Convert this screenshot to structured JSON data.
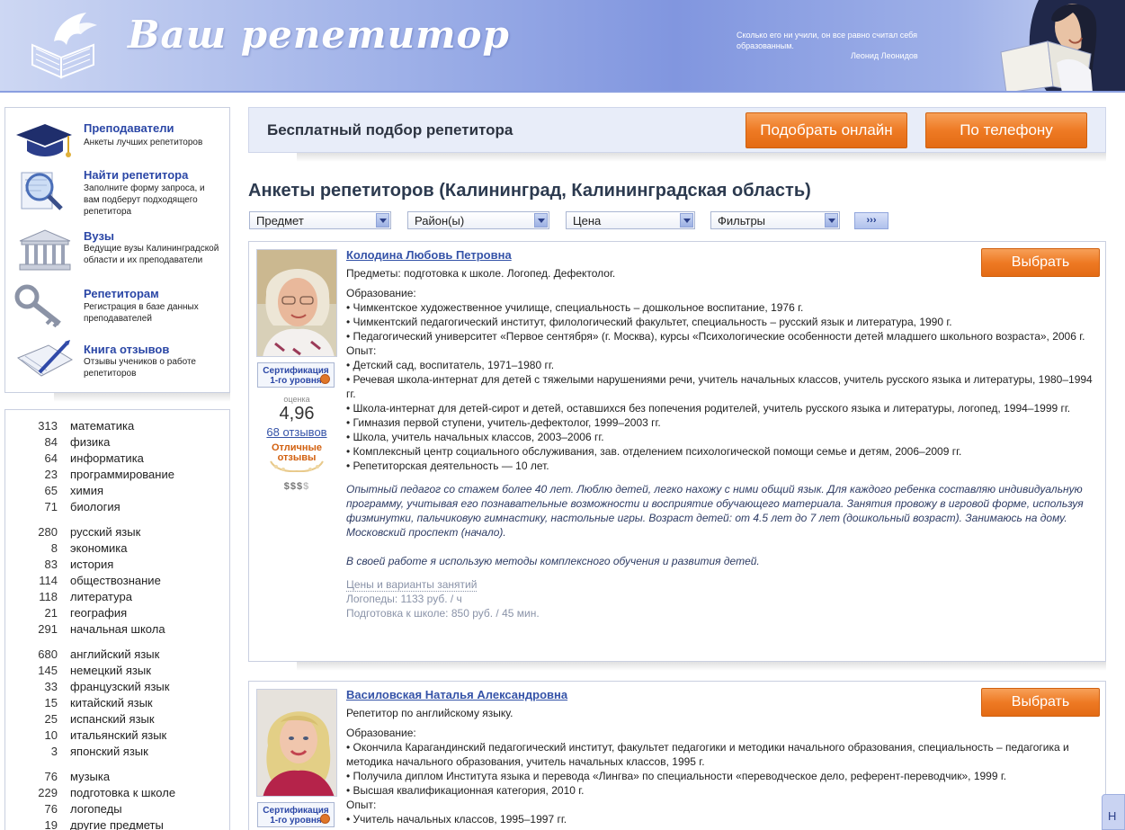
{
  "header": {
    "logo_text": "Ваш репетитор",
    "quote_text": "Сколько его ни учили, он все равно считал себя образованным.",
    "quote_author": "Леонид Леонидов"
  },
  "menu": [
    {
      "title": "Преподаватели",
      "desc": "Анкеты лучших репетиторов",
      "icon": "graduation-cap-icon"
    },
    {
      "title": "Найти репетитора",
      "desc": "Заполните форму запроса, и вам подберут подходящего репетитора",
      "icon": "magnifier-icon"
    },
    {
      "title": "Вузы",
      "desc": "Ведущие вузы Калининградской области и их преподаватели",
      "icon": "university-icon"
    },
    {
      "title": "Репетиторам",
      "desc": "Регистрация в базе данных преподавателей",
      "icon": "key-icon"
    },
    {
      "title": "Книга отзывов",
      "desc": "Отзывы учеников о работе репетиторов",
      "icon": "notebook-pen-icon"
    }
  ],
  "subjects": [
    [
      {
        "count": "313",
        "name": "математика"
      },
      {
        "count": "84",
        "name": "физика"
      },
      {
        "count": "64",
        "name": "информатика"
      },
      {
        "count": "23",
        "name": "программирование"
      },
      {
        "count": "65",
        "name": "химия"
      },
      {
        "count": "71",
        "name": "биология"
      }
    ],
    [
      {
        "count": "280",
        "name": "русский язык"
      },
      {
        "count": "8",
        "name": "экономика"
      },
      {
        "count": "83",
        "name": "история"
      },
      {
        "count": "114",
        "name": "обществознание"
      },
      {
        "count": "118",
        "name": "литература"
      },
      {
        "count": "21",
        "name": "география"
      },
      {
        "count": "291",
        "name": "начальная школа"
      }
    ],
    [
      {
        "count": "680",
        "name": "английский язык"
      },
      {
        "count": "145",
        "name": "немецкий язык"
      },
      {
        "count": "33",
        "name": "французский язык"
      },
      {
        "count": "15",
        "name": "китайский язык"
      },
      {
        "count": "25",
        "name": "испанский язык"
      },
      {
        "count": "10",
        "name": "итальянский язык"
      },
      {
        "count": "3",
        "name": "японский язык"
      }
    ],
    [
      {
        "count": "76",
        "name": "музыка"
      },
      {
        "count": "229",
        "name": "подготовка к школе"
      },
      {
        "count": "76",
        "name": "логопеды"
      },
      {
        "count": "19",
        "name": "другие предметы"
      }
    ]
  ],
  "banner": {
    "title": "Бесплатный подбор репетитора",
    "online_button": "Подобрать онлайн",
    "phone_button": "По телефону"
  },
  "page_title": "Анкеты репетиторов (Калининград, Калининградская область)",
  "filters": {
    "subject": "Предмет",
    "district": "Район(ы)",
    "price": "Цена",
    "filters": "Фильтры",
    "go": "›››"
  },
  "tutors": [
    {
      "name": "Колодина Любовь Петровна",
      "subjects": "Предметы: подготовка к школе. Логопед. Дефектолог.",
      "cert": "Сертификация 1-го уровня",
      "rating_label": "оценка",
      "rating": "4,96",
      "reviews": "68 отзывов",
      "excellent": "Отличные отзывы",
      "price_level": "$$$",
      "price_level_dim": "$",
      "choose": "Выбрать",
      "education_label": "Образование:",
      "education": [
        "• Чимкентское художественное училище, специальность – дошкольное воспитание, 1976 г.",
        "• Чимкентский педагогический институт, филологический факультет, специальность – русский язык и литература, 1990 г.",
        "• Педагогический университет «Первое сентября» (г. Москва), курсы «Психологические особенности детей младшего школьного возраста», 2006 г."
      ],
      "experience_label": "Опыт:",
      "experience": [
        "• Детский сад, воспитатель, 1971–1980 гг.",
        "• Речевая школа-интернат для детей с тяжелыми нарушениями речи, учитель начальных классов, учитель русского языка и литературы, 1980–1994 гг.",
        "• Школа-интернат для детей-сирот и детей, оставшихся без попечения родителей, учитель русского языка и литературы, логопед, 1994–1999 гг.",
        "• Гимназия первой ступени, учитель-дефектолог, 1999–2003 гг.",
        "• Школа, учитель начальных классов, 2003–2006 гг.",
        "• Комплексный центр социального обслуживания, зав. отделением психологической помощи семье и детям, 2006–2009 гг.",
        "• Репетиторская деятельность — 10 лет."
      ],
      "about1": "Опытный педагог со стажем более 40 лет. Люблю детей, легко нахожу с ними общий язык. Для каждого ребенка составляю индивидуальную программу, учитывая его познавательные возможности и восприятие обучающего материала. Занятия провожу в игровой форме, используя физминутки, пальчиковую гимнастику, настольные игры. Возраст детей: от 4.5 лет до 7 лет (дошкольный возраст). Занимаюсь на дому. Московский проспект (начало).",
      "about2": "В своей работе я использую методы комплексного обучения и развития детей.",
      "prices_link": "Цены и варианты занятий",
      "prices": [
        "Логопеды: 1133 руб. / ч",
        "Подготовка к школе: 850 руб. / 45 мин."
      ]
    },
    {
      "name": "Василовская Наталья Александровна",
      "subjects": "Репетитор по английскому языку.",
      "cert": "Сертификация 1-го уровня",
      "choose": "Выбрать",
      "education_label": "Образование:",
      "education": [
        "• Окончила Карагандинский педагогический институт, факультет педагогики и методики начального образования, специальность – педагогика и методика начального образования, учитель начальных классов, 1995 г.",
        "• Получила диплом Института языка и перевода «Лингва» по специальности «переводческое дело, референт-переводчик», 1999 г.",
        "• Высшая квалификационная категория, 2010 г."
      ],
      "experience_label": "Опыт:",
      "experience": [
        "• Учитель начальных классов, 1995–1997 гг."
      ]
    }
  ],
  "side_tab": "Н"
}
